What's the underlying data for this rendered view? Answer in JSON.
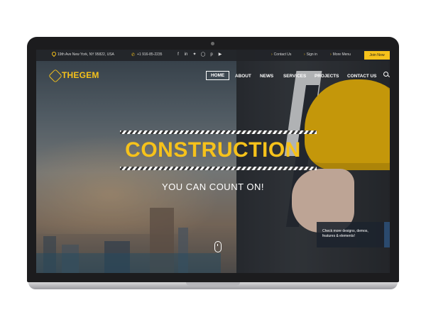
{
  "topbar": {
    "address": "19th Ave New York, NY 95822, USA",
    "phone": "+1 916-85-2235",
    "social_icons": [
      "facebook-icon",
      "linkedin-icon",
      "twitter-icon",
      "instagram-icon",
      "pinterest-icon",
      "youtube-icon"
    ],
    "links": [
      "Contact Us",
      "Sign in",
      "More Menu"
    ],
    "join_label": "Join Now"
  },
  "header": {
    "logo_text": "THEGEM",
    "nav": [
      "HOME",
      "ABOUT",
      "NEWS",
      "SERVICES",
      "PROJECTS",
      "CONTACT US"
    ]
  },
  "hero": {
    "headline": "CONSTRUCTION",
    "tagline": "YOU CAN COUNT ON!"
  },
  "promo": {
    "text": "Check more designs, demos, features & elements!"
  },
  "colors": {
    "accent": "#f6c21b",
    "topbar": "#222428",
    "laptop_frame": "#1c1c1e"
  }
}
